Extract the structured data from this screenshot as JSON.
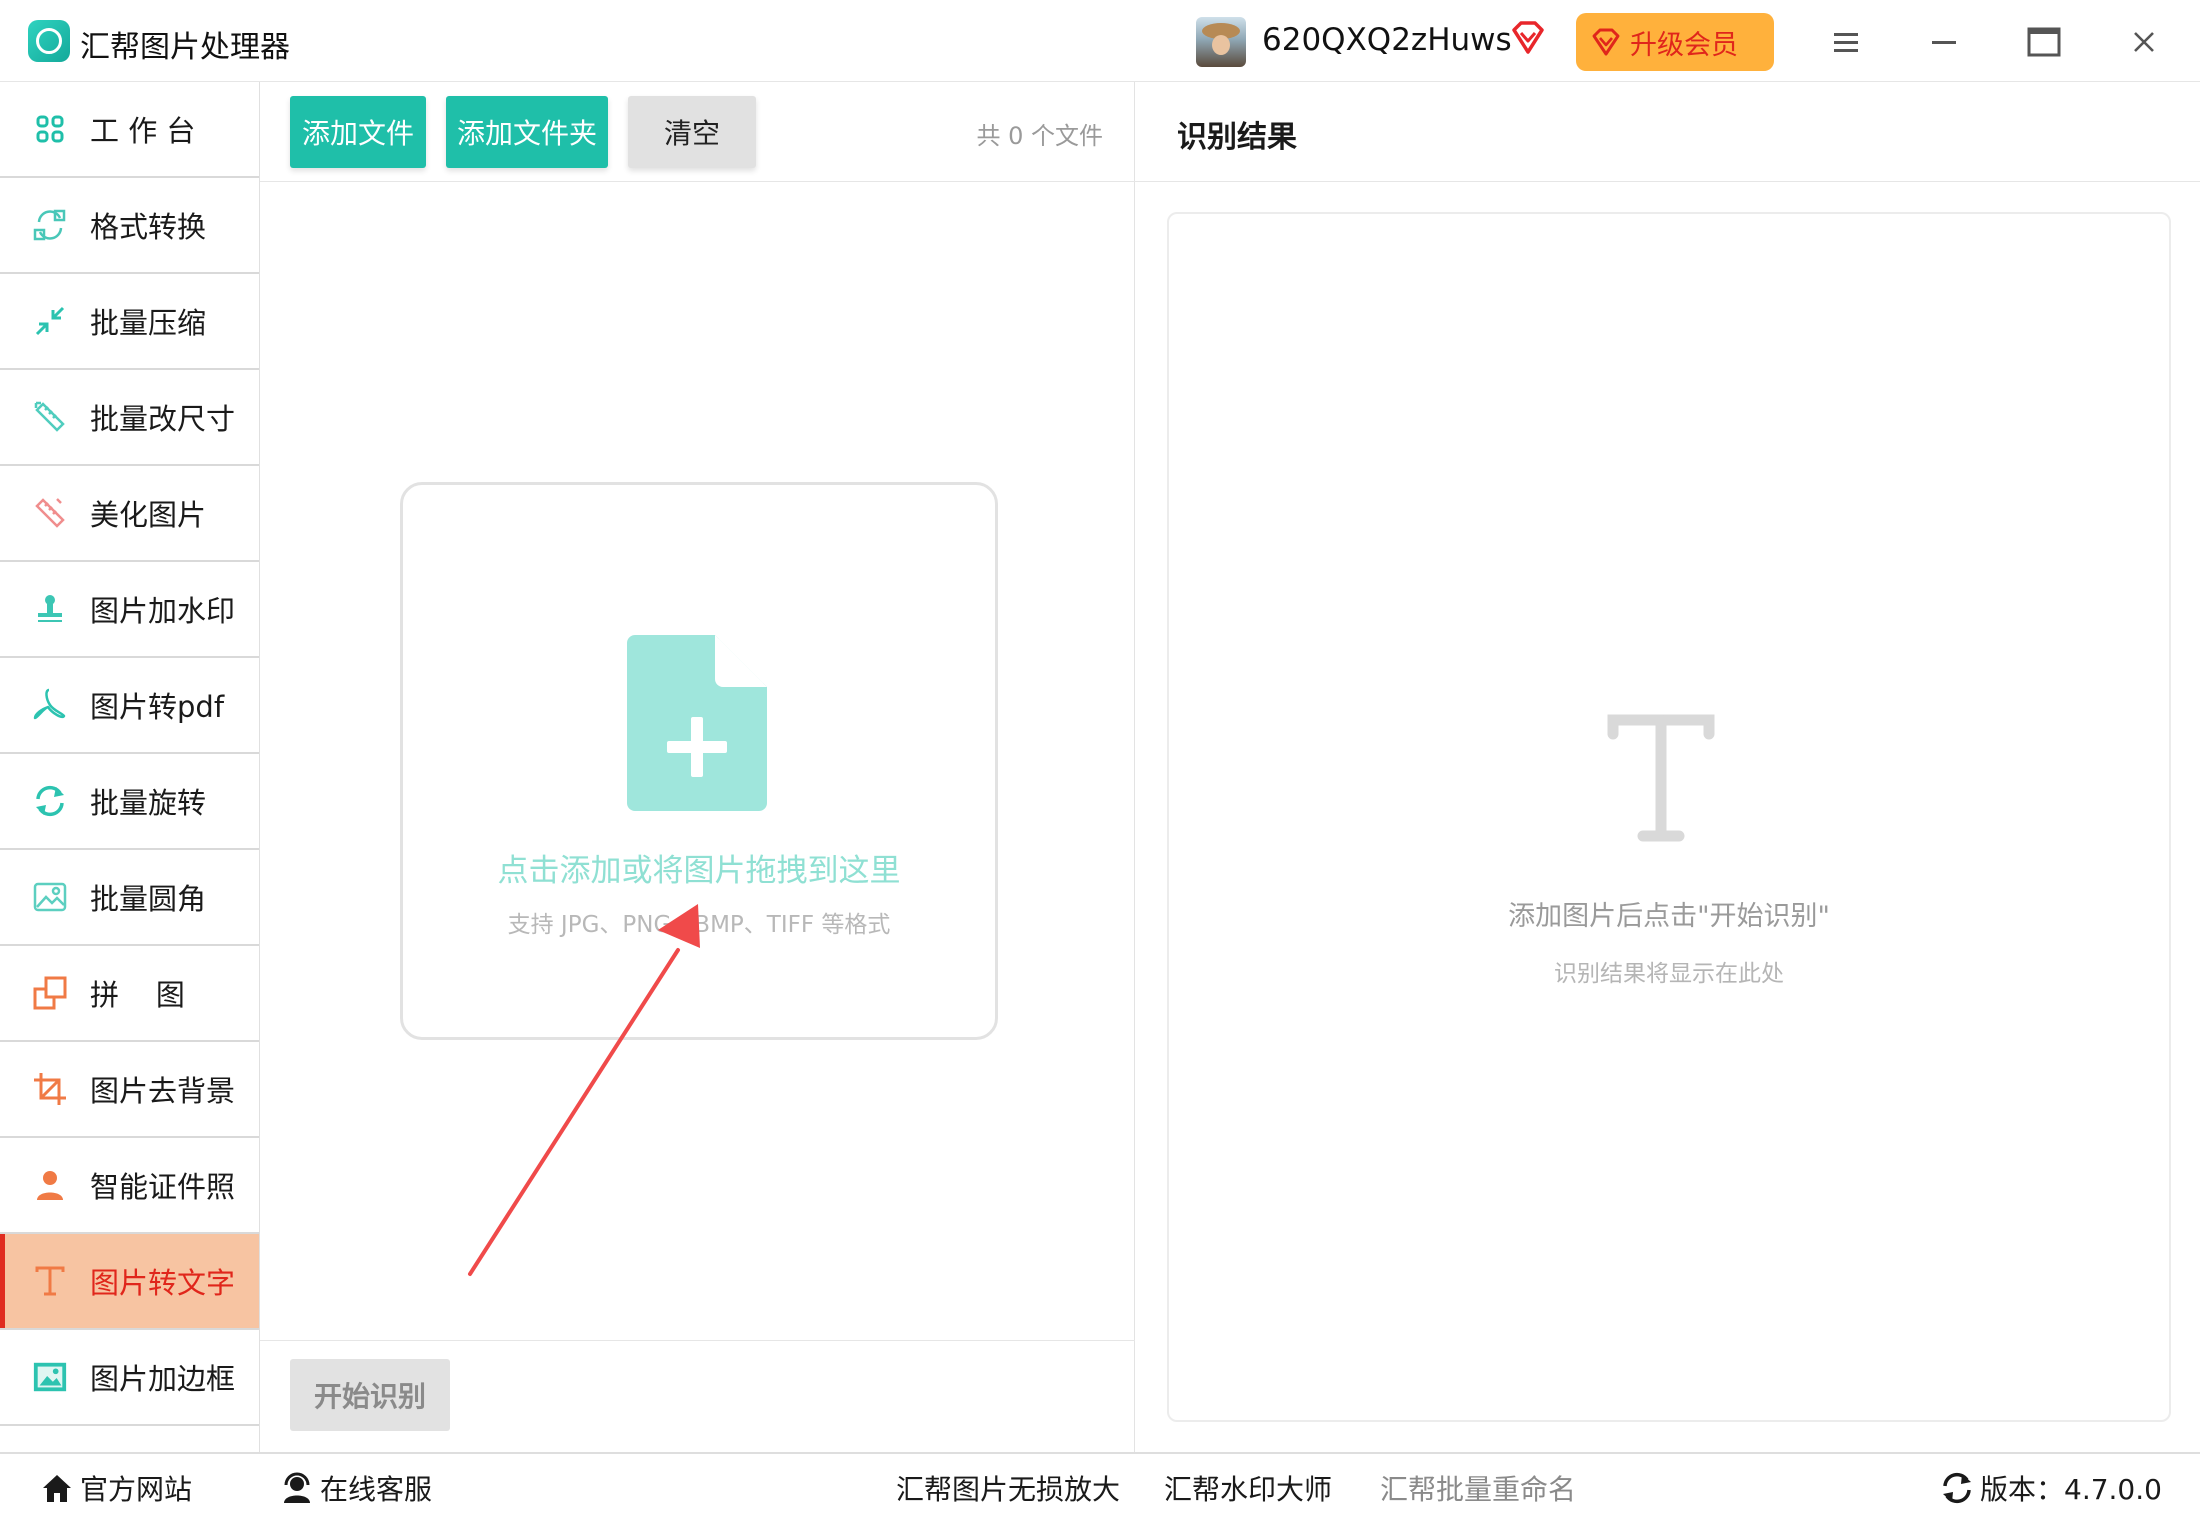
{
  "window": {
    "title": "汇帮图片处理器",
    "username": "620QXQ2zHuws",
    "upgrade_label": "升级会员"
  },
  "sidebar": {
    "items": [
      {
        "label": "工 作 台",
        "icon": "grid-icon"
      },
      {
        "label": "格式转换",
        "icon": "format-convert-icon"
      },
      {
        "label": "批量压缩",
        "icon": "compress-icon"
      },
      {
        "label": "批量改尺寸",
        "icon": "resize-icon"
      },
      {
        "label": "美化图片",
        "icon": "beautify-icon"
      },
      {
        "label": "图片加水印",
        "icon": "watermark-stamp-icon"
      },
      {
        "label": "图片转pdf",
        "icon": "pdf-icon"
      },
      {
        "label": "批量旋转",
        "icon": "rotate-icon"
      },
      {
        "label": "批量圆角",
        "icon": "rounded-image-icon"
      },
      {
        "label": "拼    图",
        "icon": "collage-icon"
      },
      {
        "label": "图片去背景",
        "icon": "crop-icon"
      },
      {
        "label": "智能证件照",
        "icon": "person-icon"
      },
      {
        "label": "图片转文字",
        "icon": "text-T-icon",
        "active": true
      },
      {
        "label": "图片加边框",
        "icon": "frame-icon"
      }
    ]
  },
  "toolbar": {
    "add_file": "添加文件",
    "add_folder": "添加文件夹",
    "clear": "清空",
    "file_count": "共 0 个文件"
  },
  "dropzone": {
    "main_text": "点击添加或将图片拖拽到这里",
    "sub_text": "支持 JPG、PNG、BMP、TIFF 等格式"
  },
  "start_button": "开始识别",
  "result": {
    "title": "识别结果",
    "hint": "添加图片后点击\"开始识别\"",
    "sub_hint": "识别结果将显示在此处"
  },
  "footer": {
    "website": "官方网站",
    "support": "在线客服",
    "link1": "汇帮图片无损放大",
    "link2": "汇帮水印大师",
    "link3": "汇帮批量重命名",
    "version_label": "版本：4.7.0.0"
  },
  "colors": {
    "accent_teal": "#1fbfa9",
    "active_bg": "#f7c4a2",
    "active_text": "#e0261b",
    "upgrade_bg": "#ffb13c",
    "arrow_red": "#f04a4a"
  }
}
